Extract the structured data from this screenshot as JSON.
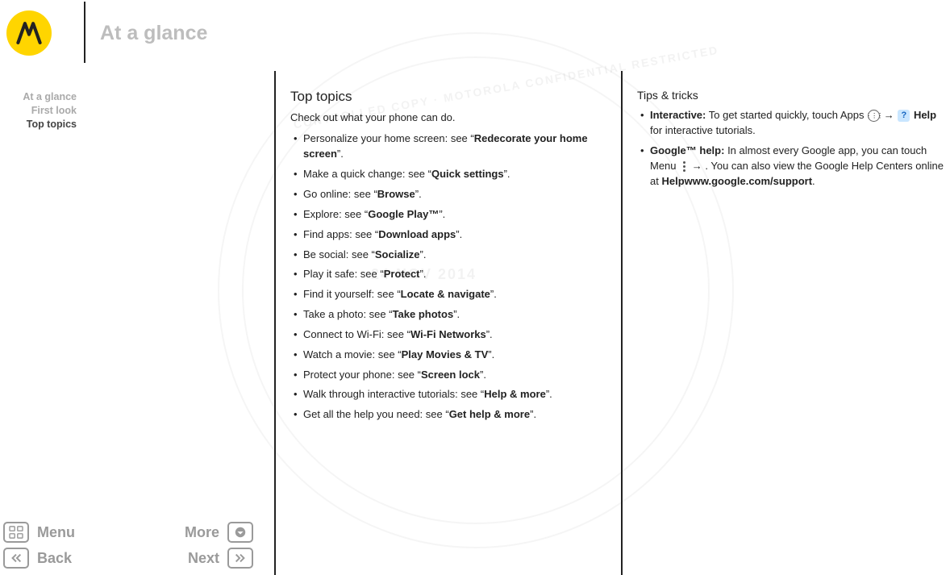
{
  "header": {
    "title": "At a glance"
  },
  "sidebar": {
    "items": [
      {
        "label": "At a glance",
        "active": false
      },
      {
        "label": "First look",
        "active": false
      },
      {
        "label": "Top topics",
        "active": true
      }
    ]
  },
  "main": {
    "heading": "Top topics",
    "intro": "Check out what your phone can do.",
    "bullets": [
      {
        "pre": "Personalize your home screen: see “",
        "bold": "Redecorate your home screen",
        "post": "”."
      },
      {
        "pre": "Make a quick change: see “",
        "bold": "Quick settings",
        "post": "”."
      },
      {
        "pre": "Go online: see “",
        "bold": "Browse",
        "post": "”."
      },
      {
        "pre": "Explore: see “",
        "bold": "Google Play™",
        "post": "”."
      },
      {
        "pre": "Find apps: see “",
        "bold": "Download apps",
        "post": "”."
      },
      {
        "pre": "Be social: see “",
        "bold": "Socialize",
        "post": "”."
      },
      {
        "pre": "Play it safe: see “",
        "bold": "Protect",
        "post": "”."
      },
      {
        "pre": "Find it yourself: see “",
        "bold": "Locate & navigate",
        "post": "”."
      },
      {
        "pre": "Take a photo: see “",
        "bold": "Take photos",
        "post": "”."
      },
      {
        "pre": "Connect to Wi-Fi: see “",
        "bold": "Wi-Fi Networks",
        "post": "”."
      },
      {
        "pre": "Watch a movie: see “",
        "bold": "Play Movies & TV",
        "post": "”."
      },
      {
        "pre": "Protect your phone: see “",
        "bold": "Screen lock",
        "post": "”."
      },
      {
        "pre": "Walk through interactive tutorials: see “",
        "bold": "Help & more",
        "post": "”."
      },
      {
        "pre": "Get all the help you need: see “",
        "bold": "Get help & more",
        "post": "”."
      }
    ]
  },
  "tips": {
    "heading": "Tips & tricks",
    "items": [
      {
        "lead_bold": "Interactive:",
        "t1": " To get started quickly, touch Apps ",
        "icon1": "apps-icon",
        "t2": " → ",
        "icon2": "help-icon",
        "t3": " ",
        "bold2": "Help",
        "t4": " for interactive tutorials."
      },
      {
        "lead_bold": "Google™ help:",
        "t1": " In almost every Google app, you can touch Menu ",
        "icon1": "menu-icon",
        "t2": " → ",
        "bold2": "Help",
        "t3": ". You can also view the Google Help Centers online at ",
        "bold3": "www.google.com/support",
        "t4": "."
      }
    ]
  },
  "nav": {
    "menu": "Menu",
    "more": "More",
    "back": "Back",
    "next": "Next"
  },
  "watermark": {
    "date": "24 NOV 2014",
    "label": "CONTROLLED COPY  ·  MOTOROLA CONFIDENTIAL RESTRICTED"
  }
}
